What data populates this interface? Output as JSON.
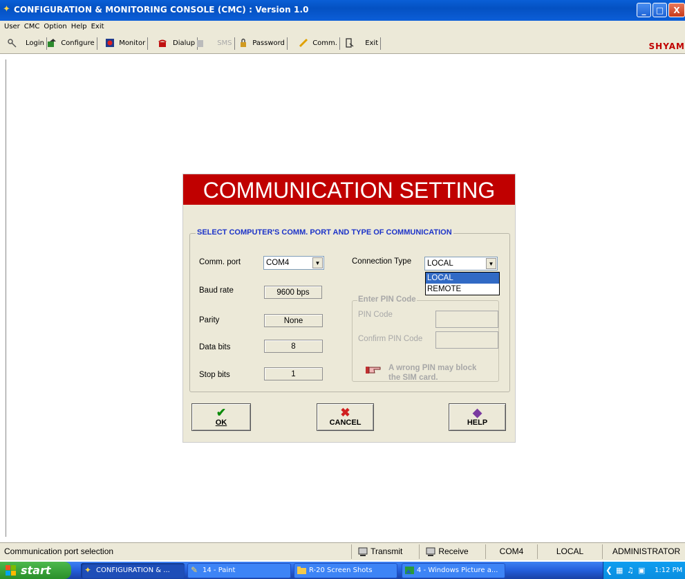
{
  "window": {
    "title": "CONFIGURATION & MONITORING CONSOLE (CMC) : Version 1.0",
    "controls": [
      "_",
      "□",
      "X"
    ]
  },
  "menu": [
    "User",
    "CMC",
    "Option",
    "Help",
    "Exit"
  ],
  "toolbar": {
    "login": "Login",
    "configure": "Configure",
    "monitor": "Monitor",
    "dialup": "Dialup",
    "sms": "SMS",
    "password": "Password",
    "comm": "Comm.",
    "exit": "Exit",
    "brand": "SHYAM"
  },
  "dialog": {
    "header": "COMMUNICATION SETTING",
    "group_title": "SELECT COMPUTER'S COMM. PORT AND TYPE OF COMMUNICATION",
    "comm_port_label": "Comm. port",
    "comm_port_value": "COM4",
    "baud_label": "Baud rate",
    "baud_value": "9600 bps",
    "parity_label": "Parity",
    "parity_value": "None",
    "databits_label": "Data bits",
    "databits_value": "8",
    "stopbits_label": "Stop bits",
    "stopbits_value": "1",
    "conn_type_label": "Connection Type",
    "conn_type_value": "LOCAL",
    "conn_type_options": [
      "LOCAL",
      "REMOTE"
    ],
    "pin_group_title": "Enter PIN Code",
    "pin_label": "PIN Code",
    "confirm_pin_label": "Confirm PIN Code",
    "warning_line1": "A wrong PIN may block",
    "warning_line2": "the SIM card.",
    "ok_label": "OK",
    "cancel_label": "CANCEL",
    "help_label": "HELP"
  },
  "status": {
    "message": "Communication port selection",
    "transmit": "Transmit",
    "receive": "Receive",
    "port": "COM4",
    "connection": "LOCAL",
    "user": "ADMINISTRATOR"
  },
  "taskbar": {
    "start": "start",
    "items": [
      "CONFIGURATION & ...",
      "14 - Paint",
      "R-20 Screen Shots",
      "4 - Windows Picture a..."
    ],
    "time": "1:12 PM"
  }
}
